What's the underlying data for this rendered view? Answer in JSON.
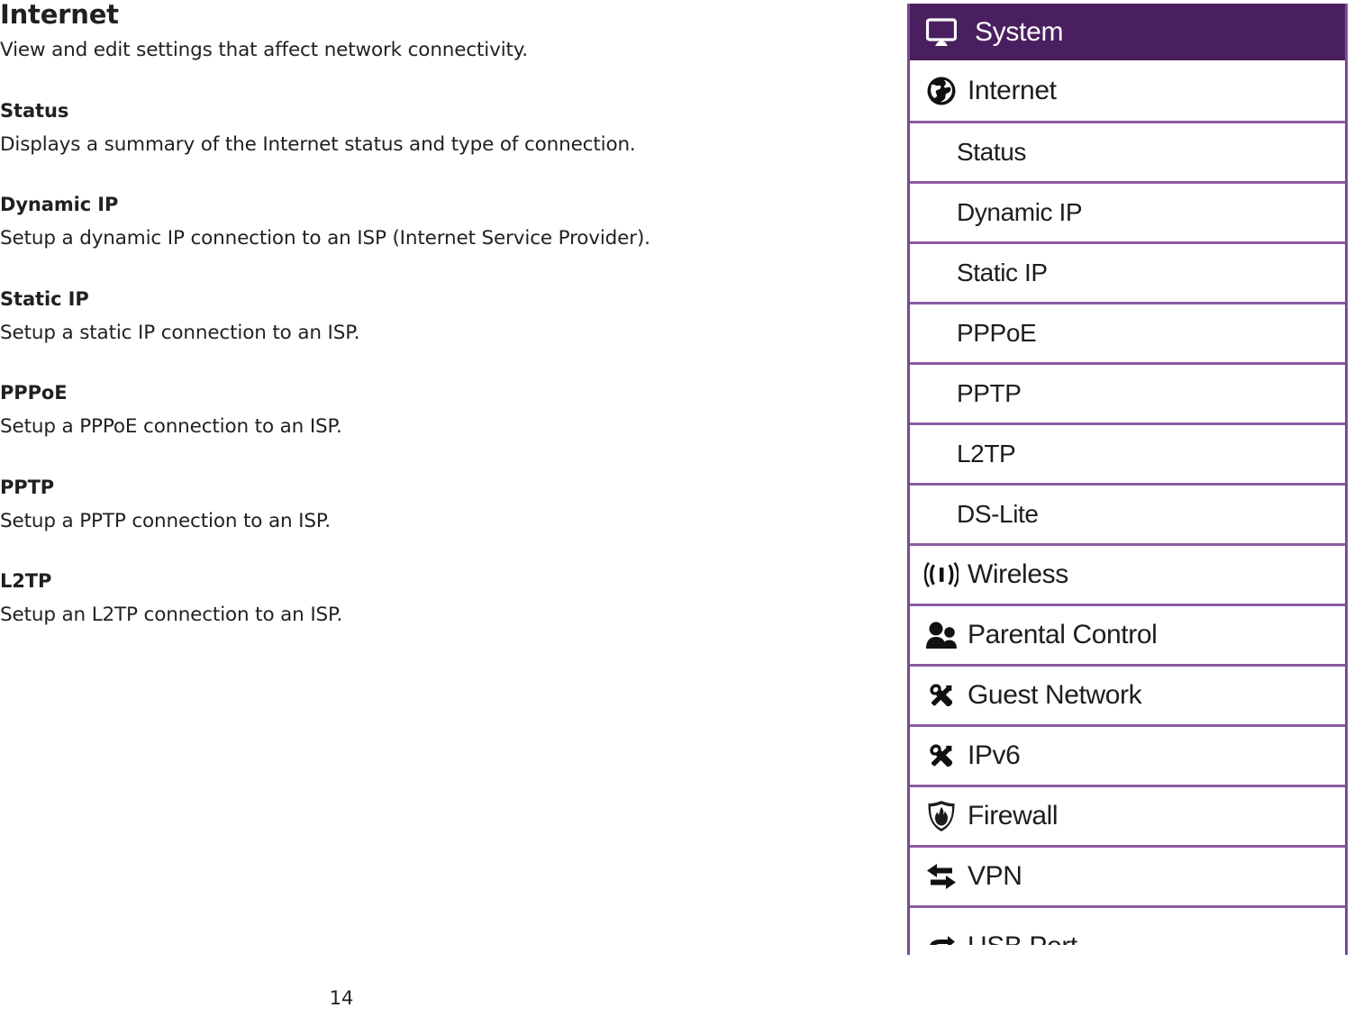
{
  "document": {
    "title": "Internet",
    "subtitle": "View and edit settings that affect network connectivity.",
    "sections": [
      {
        "heading": "Status",
        "body": "Displays a summary of the Internet status and type of connection."
      },
      {
        "heading": "Dynamic IP",
        "body": "Setup a dynamic IP connection to an ISP (Internet Service Provider)."
      },
      {
        "heading": "Static IP",
        "body": "Setup a static IP connection to an ISP."
      },
      {
        "heading": "PPPoE",
        "body": "Setup a PPPoE connection to an ISP."
      },
      {
        "heading": "PPTP",
        "body": "Setup a PPTP connection to an ISP."
      },
      {
        "heading": "L2TP",
        "body": "Setup an L2TP connection to an ISP."
      }
    ],
    "page_number": "14"
  },
  "menu_panel": {
    "header": {
      "label": "System",
      "icon": "monitor-icon",
      "background_color": "#4a1f5f",
      "text_color": "#ffffff"
    },
    "border_color": "#8a5ba0",
    "items": [
      {
        "label": "Internet",
        "icon": "globe-icon",
        "level": "top"
      },
      {
        "label": "Status",
        "icon": "",
        "level": "sub"
      },
      {
        "label": "Dynamic IP",
        "icon": "",
        "level": "sub"
      },
      {
        "label": "Static IP",
        "icon": "",
        "level": "sub"
      },
      {
        "label": "PPPoE",
        "icon": "",
        "level": "sub"
      },
      {
        "label": "PPTP",
        "icon": "",
        "level": "sub"
      },
      {
        "label": "L2TP",
        "icon": "",
        "level": "sub"
      },
      {
        "label": "DS-Lite",
        "icon": "",
        "level": "sub"
      },
      {
        "label": "Wireless",
        "icon": "wifi-icon",
        "level": "top"
      },
      {
        "label": "Parental Control",
        "icon": "people-icon",
        "level": "top"
      },
      {
        "label": "Guest Network",
        "icon": "tools-icon",
        "level": "top"
      },
      {
        "label": "IPv6",
        "icon": "tools-icon",
        "level": "top"
      },
      {
        "label": "Firewall",
        "icon": "shield-flame-icon",
        "level": "top"
      },
      {
        "label": "VPN",
        "icon": "arrows-icon",
        "level": "top"
      },
      {
        "label": "USB Port",
        "icon": "usb-icon",
        "level": "top"
      }
    ]
  }
}
